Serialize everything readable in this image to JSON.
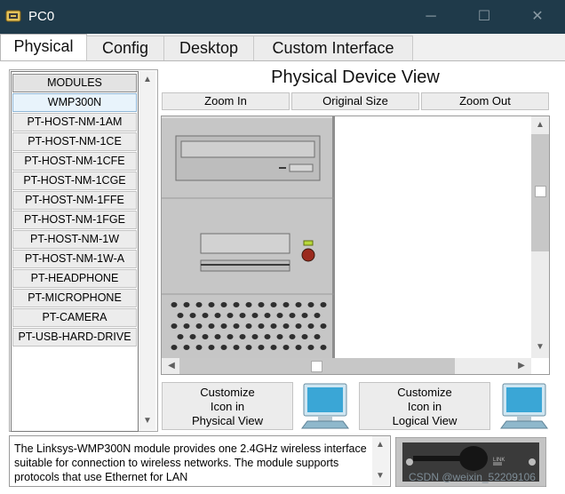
{
  "window": {
    "title": "PC0",
    "app_icon": "packet-tracer-icon"
  },
  "tabs": [
    {
      "label": "Physical",
      "active": true
    },
    {
      "label": "Config"
    },
    {
      "label": "Desktop"
    },
    {
      "label": "Custom Interface"
    }
  ],
  "modules": {
    "header": "MODULES",
    "items": [
      "WMP300N",
      "PT-HOST-NM-1AM",
      "PT-HOST-NM-1CE",
      "PT-HOST-NM-1CFE",
      "PT-HOST-NM-1CGE",
      "PT-HOST-NM-1FFE",
      "PT-HOST-NM-1FGE",
      "PT-HOST-NM-1W",
      "PT-HOST-NM-1W-A",
      "PT-HEADPHONE",
      "PT-MICROPHONE",
      "PT-CAMERA",
      "PT-USB-HARD-DRIVE"
    ],
    "selected": "WMP300N"
  },
  "physical_view": {
    "title": "Physical Device View",
    "zoom_in": "Zoom In",
    "original_size": "Original Size",
    "zoom_out": "Zoom Out"
  },
  "custom_icons": {
    "physical": [
      "Customize",
      "Icon in",
      "Physical View"
    ],
    "logical": [
      "Customize",
      "Icon in",
      "Logical View"
    ]
  },
  "description": "The Linksys-WMP300N module provides one 2.4GHz wireless interface suitable for connection to wireless networks. The module supports protocols that use Ethernet for LAN",
  "module_image_label": "LINK",
  "watermark": "CSDN @weixin_52209106",
  "colors": {
    "titlebar": "#1f3a4a",
    "monitor_screen": "#3aa6d6",
    "tower": "#c8c8c8"
  }
}
